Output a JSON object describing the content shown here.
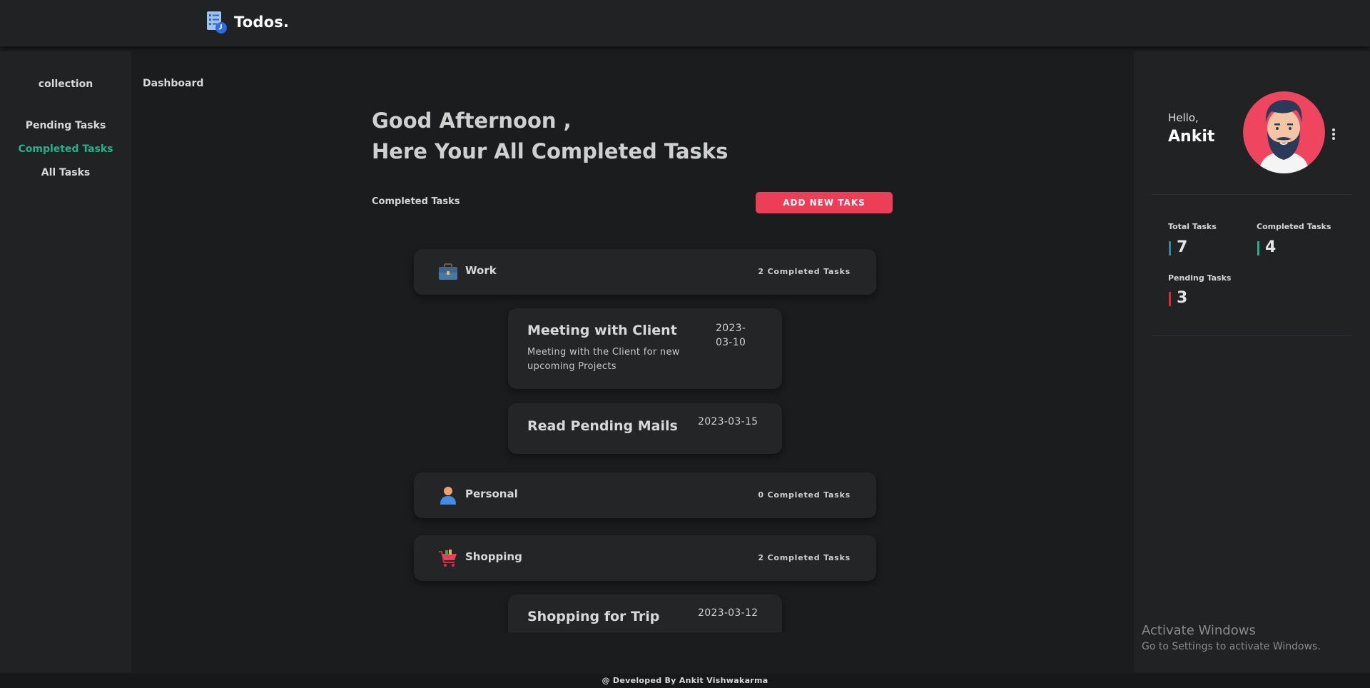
{
  "header": {
    "brand_name": "Todos."
  },
  "sidebar": {
    "heading": "collection",
    "items": [
      {
        "label": "Pending Tasks"
      },
      {
        "label": "Completed Tasks"
      },
      {
        "label": "All Tasks"
      }
    ],
    "active_item": "Completed Tasks"
  },
  "breadcrumb": {
    "label": "Dashboard"
  },
  "main": {
    "greeting_line1": "Good Afternoon ,",
    "greeting_line2": "Here Your All Completed Tasks",
    "section_label": "Completed Tasks",
    "add_button_label": "ADD NEW TAKS",
    "categories": [
      {
        "name": "Work",
        "icon": "briefcase-icon",
        "count_label": "2 Completed Tasks",
        "tasks": [
          {
            "title": "Meeting with Client",
            "description": "Meeting with the Client for new upcoming Projects",
            "date": "2023-03-10"
          },
          {
            "title": "Read Pending Mails",
            "description": "",
            "date": "2023-03-15"
          }
        ]
      },
      {
        "name": "Personal",
        "icon": "person-icon",
        "count_label": "0 Completed Tasks",
        "tasks": []
      },
      {
        "name": "Shopping",
        "icon": "shopping-cart-icon",
        "count_label": "2 Completed Tasks",
        "tasks": [
          {
            "title": "Shopping for Trip",
            "description": "",
            "date": "2023-03-12"
          }
        ]
      }
    ]
  },
  "profile": {
    "greeting": "Hello,",
    "name": "Ankit",
    "avatar_icon": "bearded-man-avatar",
    "menu_icon": "vertical-dots-icon"
  },
  "stats": {
    "total": {
      "label": "Total Tasks",
      "value": "7",
      "color": "#2a8aa6"
    },
    "completed": {
      "label": "Completed Tasks",
      "value": "4",
      "color": "#23b386"
    },
    "pending": {
      "label": "Pending Tasks",
      "value": "3",
      "color": "#e3263b"
    }
  },
  "windows_watermark": {
    "title": "Activate Windows",
    "subtitle": "Go to Settings to activate Windows."
  },
  "footer": {
    "text": "@ Developed By Ankit Vishwakarma"
  },
  "colors": {
    "accent_red": "#ee3d57",
    "accent_green": "#23b386",
    "background": "#1b1c1e",
    "panel": "#202224",
    "card": "#232527"
  }
}
